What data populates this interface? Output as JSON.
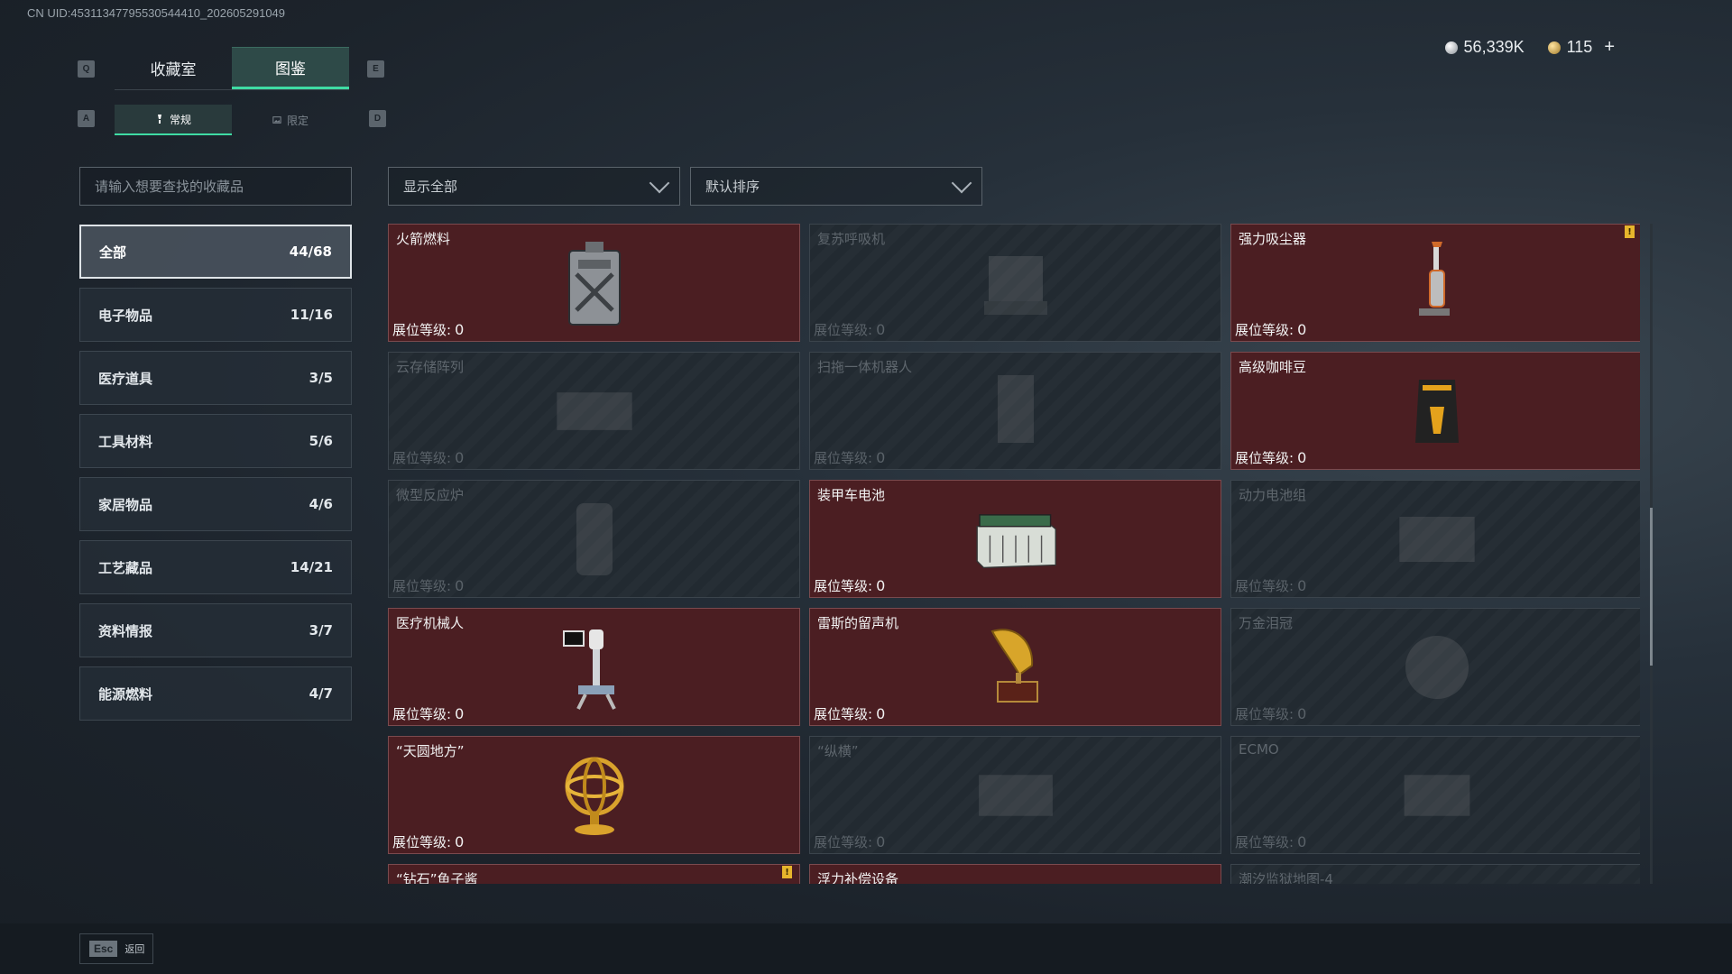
{
  "uid_text": "CN UID:45311347795530544410_202605291049",
  "keys": {
    "q": "Q",
    "e": "E",
    "a": "A",
    "d": "D"
  },
  "tabs_top": [
    {
      "label": "收藏室"
    },
    {
      "label": "图鉴",
      "active": true
    }
  ],
  "tabs_sub": [
    {
      "label": "常规",
      "active": true,
      "icon": "lamp-icon"
    },
    {
      "label": "限定",
      "icon": "image-icon"
    }
  ],
  "currency": {
    "silver": "56,339K",
    "gold": "115",
    "plus": "+"
  },
  "search": {
    "placeholder": "请输入想要查找的收藏品"
  },
  "filter": {
    "label": "显示全部"
  },
  "sort": {
    "label": "默认排序"
  },
  "categories": [
    {
      "label": "全部",
      "count": "44/68",
      "active": true
    },
    {
      "label": "电子物品",
      "count": "11/16"
    },
    {
      "label": "医疗道具",
      "count": "3/5"
    },
    {
      "label": "工具材料",
      "count": "5/6"
    },
    {
      "label": "家居物品",
      "count": "4/6"
    },
    {
      "label": "工艺藏品",
      "count": "14/21"
    },
    {
      "label": "资料情报",
      "count": "3/7"
    },
    {
      "label": "能源燃料",
      "count": "4/7"
    }
  ],
  "level_label": "展位等级:",
  "items": [
    {
      "name": "火箭燃料",
      "level": "0",
      "owned": true,
      "icon": "fuel-can-icon"
    },
    {
      "name": "复苏呼吸机",
      "level": "0",
      "owned": false,
      "icon": "ventilator-icon"
    },
    {
      "name": "强力吸尘器",
      "level": "0",
      "owned": true,
      "icon": "vacuum-icon",
      "badge": "!"
    },
    {
      "name": "云存储阵列",
      "level": "0",
      "owned": false,
      "icon": "storage-array-icon"
    },
    {
      "name": "扫拖一体机器人",
      "level": "0",
      "owned": false,
      "icon": "robot-mop-icon"
    },
    {
      "name": "高级咖啡豆",
      "level": "0",
      "owned": true,
      "icon": "coffee-bag-icon"
    },
    {
      "name": "微型反应炉",
      "level": "0",
      "owned": false,
      "icon": "reactor-icon"
    },
    {
      "name": "装甲车电池",
      "level": "0",
      "owned": true,
      "icon": "battery-icon"
    },
    {
      "name": "动力电池组",
      "level": "0",
      "owned": false,
      "icon": "battery-pack-icon"
    },
    {
      "name": "医疗机械人",
      "level": "0",
      "owned": true,
      "icon": "medical-robot-icon"
    },
    {
      "name": "雷斯的留声机",
      "level": "0",
      "owned": true,
      "icon": "gramophone-icon"
    },
    {
      "name": "万金泪冠",
      "level": "0",
      "owned": false,
      "icon": "crown-icon"
    },
    {
      "name": "“天圆地方”",
      "level": "0",
      "owned": true,
      "icon": "armillary-sphere-icon"
    },
    {
      "name": "“纵横”",
      "level": "0",
      "owned": false,
      "icon": "chessboard-icon"
    },
    {
      "name": "ECMO",
      "level": "0",
      "owned": false,
      "icon": "ecmo-icon"
    },
    {
      "name": "“钻石”鱼子酱",
      "level": "",
      "owned": true,
      "icon": "caviar-icon",
      "badge": "!"
    },
    {
      "name": "浮力补偿设备",
      "level": "",
      "owned": true,
      "icon": "bcd-icon"
    },
    {
      "name": "潮汐监狱地图-4",
      "level": "",
      "owned": false,
      "icon": "map-icon"
    }
  ],
  "footer": {
    "key": "Esc",
    "label": "返回"
  },
  "colors": {
    "accent": "#3fdca4",
    "owned_bg": "#4b1e22",
    "badge": "#e7b52c"
  }
}
